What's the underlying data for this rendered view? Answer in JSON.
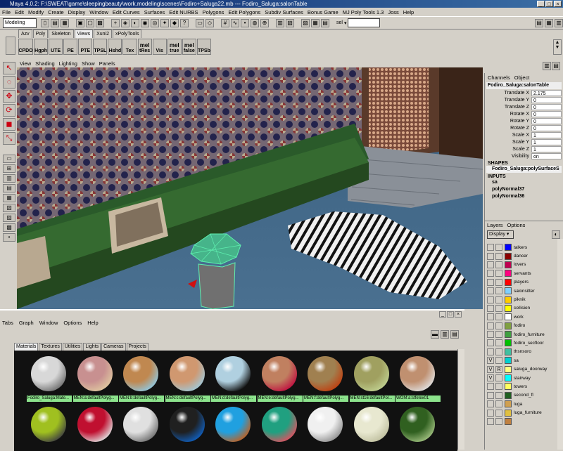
{
  "window": {
    "title": "Maya 4.0.2: F:\\SWEAT\\game\\sleepingbeauty\\work.modeling\\scenes\\Fodiro+Saluga22.mb  ---  Fodiro_Saluga:salonTable"
  },
  "menubar": [
    "File",
    "Edit",
    "Modify",
    "Create",
    "Display",
    "Window",
    "Edit Curves",
    "Surfaces",
    "Edit NURBS",
    "Polygons",
    "Edit Polygons",
    "Subdiv Surfaces",
    "Bonus Game",
    "MJ Poly Tools 1.3",
    "Joss",
    "Help"
  ],
  "toolbar": {
    "mode": "Modeling",
    "sel_label": "sel"
  },
  "shelf_tabs": [
    "Azv",
    "Poly",
    "Skeleton",
    "Views",
    "Xuni2",
    "xPolyTools"
  ],
  "shelf_active_tab": "Views",
  "shelf_buttons": [
    {
      "top": "",
      "label": "CPDO"
    },
    {
      "top": "",
      "label": "Hgph"
    },
    {
      "top": "",
      "label": "UTE"
    },
    {
      "top": "",
      "label": "PE"
    },
    {
      "top": "",
      "label": "PTE"
    },
    {
      "top": "",
      "label": "TPSL"
    },
    {
      "top": "",
      "label": "Hshd"
    },
    {
      "top": "",
      "label": "Tex"
    },
    {
      "top": "mel",
      "label": "tRes"
    },
    {
      "top": "",
      "label": "Vis"
    },
    {
      "top": "mel",
      "label": "true"
    },
    {
      "top": "mel",
      "label": "false"
    },
    {
      "top": "",
      "label": "TPSb"
    }
  ],
  "panel_menu": [
    "View",
    "Shading",
    "Lighting",
    "Show",
    "Panels"
  ],
  "channel_box": {
    "tabs": [
      "Channels",
      "Object"
    ],
    "object": "Fodiro_Saluga:salonTable",
    "channels": [
      {
        "label": "Translate X",
        "value": "2.175"
      },
      {
        "label": "Translate Y",
        "value": "0"
      },
      {
        "label": "Translate Z",
        "value": "0"
      },
      {
        "label": "Rotate X",
        "value": "0"
      },
      {
        "label": "Rotate Y",
        "value": "0"
      },
      {
        "label": "Rotate Z",
        "value": "0"
      },
      {
        "label": "Scale X",
        "value": "1"
      },
      {
        "label": "Scale Y",
        "value": "1"
      },
      {
        "label": "Scale Z",
        "value": "1"
      },
      {
        "label": "Visibility",
        "value": "on"
      }
    ],
    "shapes_header": "SHAPES",
    "shape": "Fodiro_Saluga:polySurfaceS",
    "inputs_header": "INPUTS",
    "inputs": [
      "sa",
      "polyNormal37",
      "polyNormal36"
    ]
  },
  "layer_editor": {
    "menu": [
      "Layers",
      "Options"
    ],
    "display": "Display",
    "layers": [
      {
        "name": "talkers",
        "color": "#0000ff",
        "v": "",
        "r": ""
      },
      {
        "name": "dancer",
        "color": "#8b0000",
        "v": "",
        "r": ""
      },
      {
        "name": "lovers",
        "color": "#c0004f",
        "v": "",
        "r": ""
      },
      {
        "name": "servants",
        "color": "#ff0080",
        "v": "",
        "r": ""
      },
      {
        "name": "players",
        "color": "#ff0000",
        "v": "",
        "r": ""
      },
      {
        "name": "salonsitter",
        "color": "#80d0ff",
        "v": "",
        "r": ""
      },
      {
        "name": "piknik",
        "color": "#ffcc00",
        "v": "",
        "r": ""
      },
      {
        "name": "collision",
        "color": "#ffff00",
        "v": "",
        "r": ""
      },
      {
        "name": "work",
        "color": "#ffffff",
        "v": "",
        "r": ""
      },
      {
        "name": "fodiro",
        "color": "#80a040",
        "v": "",
        "r": ""
      },
      {
        "name": "fodiro_furniture",
        "color": "#40a040",
        "v": "",
        "r": ""
      },
      {
        "name": "fodiro_secfloor",
        "color": "#00c000",
        "v": "",
        "r": ""
      },
      {
        "name": "thsnsoro",
        "color": "#40c0a0",
        "v": "",
        "r": ""
      },
      {
        "name": "sa",
        "color": "#00d0d0",
        "v": "V",
        "r": ""
      },
      {
        "name": "saluga_doorway",
        "color": "#ffff80",
        "v": "V",
        "r": "R"
      },
      {
        "name": "stairway",
        "color": "#00ffff",
        "v": "V",
        "r": ""
      },
      {
        "name": "towers",
        "color": "#ffff60",
        "v": "",
        "r": ""
      },
      {
        "name": "second_fl",
        "color": "#206020",
        "v": "",
        "r": ""
      },
      {
        "name": "luga",
        "color": "#d0a050",
        "v": "",
        "r": ""
      },
      {
        "name": "luga_furniture",
        "color": "#e0c040",
        "v": "",
        "r": ""
      },
      {
        "name": "",
        "color": "#c08040",
        "v": "",
        "r": ""
      }
    ]
  },
  "hypershade": {
    "menu": [
      "Tabs",
      "Graph",
      "Window",
      "Options",
      "Help"
    ],
    "tabs": [
      "Materials",
      "Textures",
      "Utilities",
      "Lights",
      "Cameras",
      "Projects"
    ],
    "materials": [
      {
        "label": "Fodiro_Saluga:Mate...",
        "a": "#d8d8d8",
        "b": "#707070"
      },
      {
        "label": "MEN:a:defaultPolyg...",
        "a": "#c89090",
        "b": "#e0c8a0"
      },
      {
        "label": "MEN:b:defaultPolyg...",
        "a": "#c08850",
        "b": "#90c8e0"
      },
      {
        "label": "MEN:c:defaultPolyg...",
        "a": "#d09870",
        "b": "#a0c8d8"
      },
      {
        "label": "MEN:d:defaultPolyg...",
        "a": "#b0d0e0",
        "b": "#101010"
      },
      {
        "label": "MEN:e:defaultPolyg...",
        "a": "#c08060",
        "b": "#c01040"
      },
      {
        "label": "MEN:f:defaultPolyg...",
        "a": "#a08050",
        "b": "#c04010"
      },
      {
        "label": "MEN:st16:defaultPol...",
        "a": "#a0a060",
        "b": "#c0d090"
      },
      {
        "label": "WOM:a:stfetex01",
        "a": "#c09070",
        "b": "#e0e0e0"
      }
    ],
    "materials_row2": [
      {
        "a": "#a0c020",
        "b": "#404040"
      },
      {
        "a": "#c01030",
        "b": "#e0e0e0"
      },
      {
        "a": "#e0e0e0",
        "b": "#707070"
      },
      {
        "a": "#202020",
        "b": "#1060c0"
      },
      {
        "a": "#20a0e0",
        "b": "#c06020"
      },
      {
        "a": "#20a080",
        "b": "#e05060"
      },
      {
        "a": "#f0f0f0",
        "b": "#909090"
      },
      {
        "a": "#e8e8d0",
        "b": "#c0c0a0"
      },
      {
        "a": "#306020",
        "b": "#a0c080"
      }
    ]
  }
}
